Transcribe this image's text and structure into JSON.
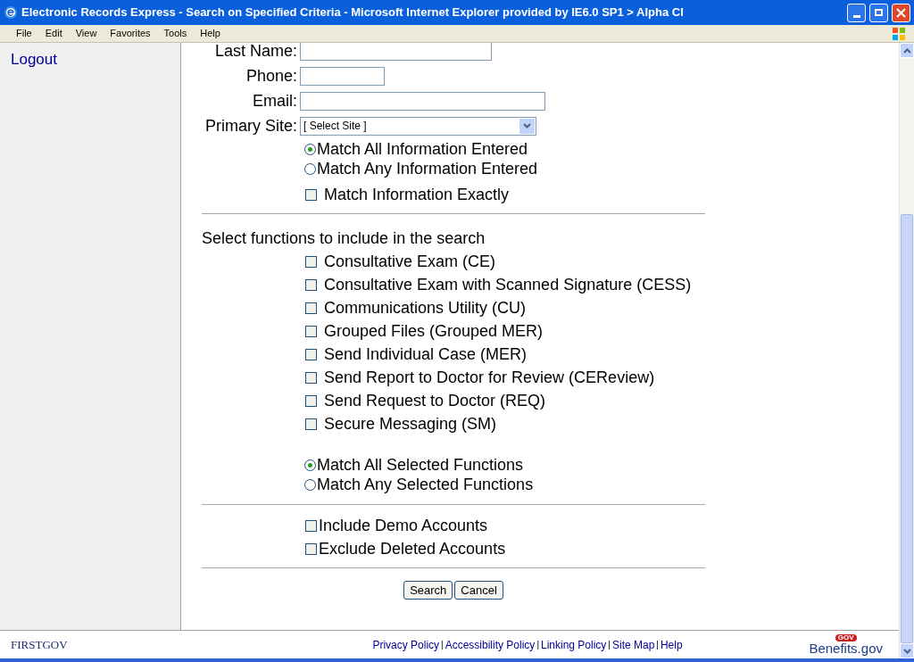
{
  "window": {
    "title": "Electronic Records Express - Search on Specified Criteria - Microsoft Internet Explorer provided by IE6.0 SP1  > Alpha CI"
  },
  "menu": [
    "File",
    "Edit",
    "View",
    "Favorites",
    "Tools",
    "Help"
  ],
  "sidebar": {
    "link": "Logout"
  },
  "fields": [
    {
      "label": "Last Name:",
      "kind": "text"
    },
    {
      "label": "Phone:",
      "kind": "text"
    },
    {
      "label": "Email:",
      "kind": "text"
    },
    {
      "label": "Primary Site:",
      "kind": "select",
      "value": "[ Select Site ]"
    }
  ],
  "info_match": [
    {
      "label": "Match All Information Entered",
      "selected": true
    },
    {
      "label": "Match Any Information Entered",
      "selected": false
    }
  ],
  "exact": {
    "label": "Match Information Exactly",
    "checked": false
  },
  "functions_heading": "Select functions to include in the search",
  "functions": [
    {
      "label": "Consultative Exam (CE)",
      "checked": false
    },
    {
      "label": "Consultative Exam with Scanned Signature (CESS)",
      "checked": false
    },
    {
      "label": "Communications Utility (CU)",
      "checked": false
    },
    {
      "label": "Grouped Files (Grouped MER)",
      "checked": false
    },
    {
      "label": "Send Individual Case (MER)",
      "checked": false
    },
    {
      "label": "Send Report to Doctor for Review (CEReview)",
      "checked": false
    },
    {
      "label": "Send Request to Doctor (REQ)",
      "checked": false
    },
    {
      "label": "Secure Messaging (SM)",
      "checked": false
    }
  ],
  "function_match": [
    {
      "label": "Match All Selected Functions",
      "selected": true
    },
    {
      "label": "Match Any Selected Functions",
      "selected": false
    }
  ],
  "accounts": [
    {
      "label": "Include Demo Accounts",
      "checked": false
    },
    {
      "label": "Exclude Deleted Accounts",
      "checked": false
    }
  ],
  "buttons": [
    "Search",
    "Cancel"
  ],
  "footer": {
    "left_logo": "FIRSTGOV",
    "links": [
      "Privacy Policy",
      "Accessibility Policy",
      "Linking Policy",
      "Site Map",
      "Help"
    ],
    "separator": "|",
    "right_badge": "GOV",
    "right_logo": "Benefits.gov"
  }
}
